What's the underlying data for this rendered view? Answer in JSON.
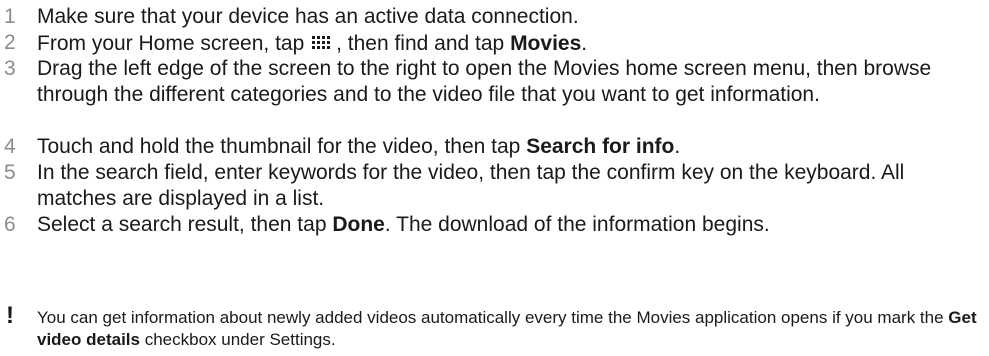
{
  "steps": [
    {
      "number": "1",
      "text": "Make sure that your device has an active data connection."
    },
    {
      "number": "2",
      "text_before_icon": "From your Home screen, tap ",
      "icon": "apps-grid-icon",
      "text_after_icon": ", then find and tap ",
      "bold": "Movies",
      "text_end": "."
    },
    {
      "number": "3",
      "text": "Drag the left edge of the screen to the right to open the Movies home screen menu, then browse through the different categories and to the video file that you want to get information."
    },
    {
      "number": "4",
      "text_before_bold": "Touch and hold the thumbnail for the video, then tap ",
      "bold": "Search for info",
      "text_end": "."
    },
    {
      "number": "5",
      "text": "In the search field, enter keywords for the video, then tap the confirm key on the keyboard. All matches are displayed in a list."
    },
    {
      "number": "6",
      "text_before_bold": "Select a search result, then tap ",
      "bold": "Done",
      "text_end": ". The download of the information begins."
    }
  ],
  "note": {
    "icon": "exclamation-icon",
    "symbol": "!",
    "text_before_bold": "You can get information about newly added videos automatically every time the Movies application opens if you mark the ",
    "bold": "Get video details",
    "text_end": " checkbox under Settings."
  },
  "colors": {
    "text": "#1a1a1a",
    "step_number": "#8c8c8c"
  }
}
